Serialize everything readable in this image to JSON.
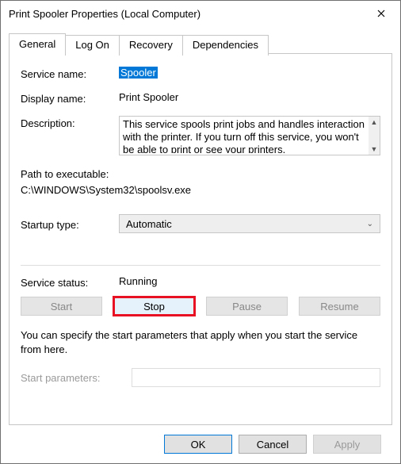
{
  "window": {
    "title": "Print Spooler Properties (Local Computer)"
  },
  "tabs": {
    "general": "General",
    "logon": "Log On",
    "recovery": "Recovery",
    "dependencies": "Dependencies"
  },
  "general": {
    "serviceNameLabel": "Service name:",
    "serviceName": "Spooler",
    "displayNameLabel": "Display name:",
    "displayName": "Print Spooler",
    "descriptionLabel": "Description:",
    "description": "This service spools print jobs and handles interaction with the printer.  If you turn off this service, you won't be able to print or see your printers.",
    "pathLabel": "Path to executable:",
    "path": "C:\\WINDOWS\\System32\\spoolsv.exe",
    "startupTypeLabel": "Startup type:",
    "startupType": "Automatic",
    "serviceStatusLabel": "Service status:",
    "serviceStatus": "Running",
    "buttons": {
      "start": "Start",
      "stop": "Stop",
      "pause": "Pause",
      "resume": "Resume"
    },
    "helpText": "You can specify the start parameters that apply when you start the service from here.",
    "startParamsLabel": "Start parameters:",
    "startParamsValue": ""
  },
  "footer": {
    "ok": "OK",
    "cancel": "Cancel",
    "apply": "Apply"
  }
}
